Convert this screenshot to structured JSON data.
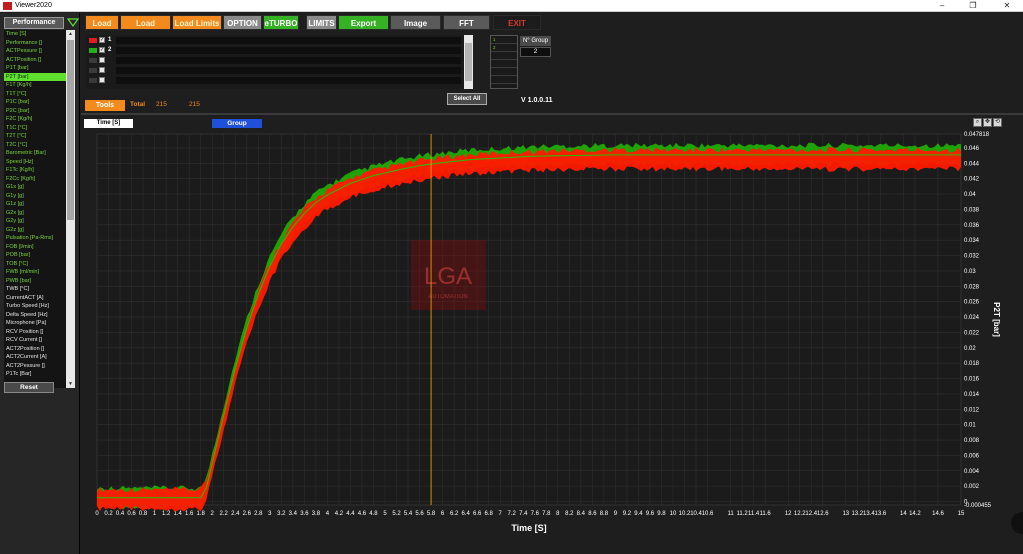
{
  "window": {
    "title": "Viewer2020",
    "minimize": "–",
    "restore": "❐",
    "close": "✕"
  },
  "sidebar": {
    "performance_label": "Performance",
    "selected_index": 8,
    "signals": [
      {
        "label": "Time [S]",
        "color": "green"
      },
      {
        "label": "Performance []",
        "color": "green"
      },
      {
        "label": "ACTPessure []",
        "color": "green"
      },
      {
        "label": "ACTPosition []",
        "color": "green"
      },
      {
        "label": "P1T [bar]",
        "color": "green"
      },
      {
        "label": "P2T [bar]",
        "color": "selected"
      },
      {
        "label": "F1T [Kg/h]",
        "color": "green"
      },
      {
        "label": "T1T [°C]",
        "color": "green"
      },
      {
        "label": "P1C [bar]",
        "color": "green"
      },
      {
        "label": "P2C [bar]",
        "color": "green"
      },
      {
        "label": "F2C [Kg/h]",
        "color": "green"
      },
      {
        "label": "T1C [°C]",
        "color": "green"
      },
      {
        "label": "T2T [°C]",
        "color": "green"
      },
      {
        "label": "T2C [°C]",
        "color": "green"
      },
      {
        "label": "Barometric [Bar]",
        "color": "green"
      },
      {
        "label": "Speed [Hz]",
        "color": "green"
      },
      {
        "label": "F1Tc [Kg/h]",
        "color": "green"
      },
      {
        "label": "F2Cc [Kg/h]",
        "color": "green"
      },
      {
        "label": "G1x [g]",
        "color": "green"
      },
      {
        "label": "G1y [g]",
        "color": "green"
      },
      {
        "label": "G1z [g]",
        "color": "green"
      },
      {
        "label": "G2x [g]",
        "color": "green"
      },
      {
        "label": "G2y [g]",
        "color": "green"
      },
      {
        "label": "G2z [g]",
        "color": "green"
      },
      {
        "label": "Pulsation [Pa-Rms]",
        "color": "green"
      },
      {
        "label": "FOB [l/min]",
        "color": "green"
      },
      {
        "label": "POB [bar]",
        "color": "green"
      },
      {
        "label": "TOB [°C]",
        "color": "green"
      },
      {
        "label": "FWB [ml/min]",
        "color": "green"
      },
      {
        "label": "PWB [bar]",
        "color": "green"
      },
      {
        "label": "TWB [°C]",
        "color": "white"
      },
      {
        "label": "CurrentACT [A]",
        "color": "white"
      },
      {
        "label": "Turbo Speed [Hz]",
        "color": "white"
      },
      {
        "label": "Delta Speed [Hz]",
        "color": "white"
      },
      {
        "label": "Microphone [Pa]",
        "color": "white"
      },
      {
        "label": "RCV Position []",
        "color": "white"
      },
      {
        "label": "RCV Current []",
        "color": "white"
      },
      {
        "label": "ACT2Position []",
        "color": "white"
      },
      {
        "label": "ACT2Current [A]",
        "color": "white"
      },
      {
        "label": "ACT2Pessure []",
        "color": "white"
      },
      {
        "label": "P1Tc [Bar]",
        "color": "white"
      }
    ],
    "reset_label": "Reset"
  },
  "toolbar": {
    "load": "Load",
    "load_groups": "Load Groups",
    "load_limits": "Load Limits",
    "option": "OPTION",
    "eturbo": "eTURBO",
    "limits": "LIMITS",
    "export": "Export",
    "image": "Image",
    "fft": "FFT",
    "exit": "EXIT"
  },
  "channels": [
    {
      "num": "1",
      "color": "#e01c1c",
      "checked": true
    },
    {
      "num": "2",
      "color": "#22b014",
      "checked": true
    },
    {
      "num": "",
      "color": "#3a3a3a",
      "checked": false
    },
    {
      "num": "",
      "color": "#3a3a3a",
      "checked": false
    },
    {
      "num": "",
      "color": "#3a3a3a",
      "checked": false
    }
  ],
  "select_all_label": "Select All",
  "group_panel": {
    "label": "N° Group",
    "value": "2",
    "items": [
      "1",
      "2",
      "",
      "",
      "",
      ""
    ]
  },
  "version": "V 1.0.0.11",
  "tools": {
    "label": "Tools",
    "total_label": "Total",
    "total_value_1": "215",
    "total_value_2": "215"
  },
  "chart_header": {
    "x_variable": "Time [S]",
    "group_label": "Group"
  },
  "colors": {
    "accent": "#f28a1e",
    "green": "#34b224",
    "grid": "#2f2f2f",
    "background": "#1e1e1e",
    "series_red": "#ff1a00",
    "series_green": "#21c400",
    "cursor": "#ffaa00"
  },
  "chart_data": {
    "type": "line",
    "xlabel": "Time [S]",
    "ylabel": "P2T [bar]",
    "xlim": [
      0,
      15
    ],
    "ylim": [
      -0.000455,
      0.047818
    ],
    "x_ticks": [
      "0",
      "0.2",
      "0.4",
      "0.6",
      "0.8",
      "1",
      "1.2",
      "1.4",
      "1.6",
      "1.8",
      "2",
      "2.2",
      "2.4",
      "2.6",
      "2.8",
      "3",
      "3.2",
      "3.4",
      "3.6",
      "3.8",
      "4",
      "4.2",
      "4.4",
      "4.6",
      "4.8",
      "5",
      "5.2",
      "5.4",
      "5.6",
      "5.8",
      "6",
      "6.2",
      "6.4",
      "6.6",
      "6.8",
      "7",
      "7.2",
      "7.4",
      "7.6",
      "7.8",
      "8",
      "8.2",
      "8.4",
      "8.6",
      "8.8",
      "9",
      "9.2",
      "9.4",
      "9.6",
      "9.8",
      "10",
      "10.2",
      "10.4",
      "10.6",
      "11",
      "11.2",
      "11.4",
      "11.6",
      "12",
      "12.2",
      "12.4",
      "12.6",
      "13",
      "13.2",
      "13.4",
      "13.6",
      "14",
      "14.2",
      "14.6",
      "15"
    ],
    "x_tick_values": [
      0,
      0.2,
      0.4,
      0.6,
      0.8,
      1,
      1.2,
      1.4,
      1.6,
      1.8,
      2,
      2.2,
      2.4,
      2.6,
      2.8,
      3,
      3.2,
      3.4,
      3.6,
      3.8,
      4,
      4.2,
      4.4,
      4.6,
      4.8,
      5,
      5.2,
      5.4,
      5.6,
      5.8,
      6,
      6.2,
      6.4,
      6.6,
      6.8,
      7,
      7.2,
      7.4,
      7.6,
      7.8,
      8,
      8.2,
      8.4,
      8.6,
      8.8,
      9,
      9.2,
      9.4,
      9.6,
      9.8,
      10,
      10.2,
      10.4,
      10.6,
      11,
      11.2,
      11.4,
      11.6,
      12,
      12.2,
      12.4,
      12.6,
      13,
      13.2,
      13.4,
      13.6,
      14,
      14.2,
      14.6,
      15
    ],
    "y_ticks": [
      "-0.000455",
      "0",
      "0.002",
      "0.004",
      "0.006",
      "0.008",
      "0.01",
      "0.012",
      "0.014",
      "0.016",
      "0.018",
      "0.02",
      "0.022",
      "0.024",
      "0.026",
      "0.028",
      "0.03",
      "0.032",
      "0.034",
      "0.036",
      "0.038",
      "0.04",
      "0.042",
      "0.044",
      "0.046",
      "0.047818"
    ],
    "y_tick_values": [
      -0.000455,
      0,
      0.002,
      0.004,
      0.006,
      0.008,
      0.01,
      0.012,
      0.014,
      0.016,
      0.018,
      0.02,
      0.022,
      0.024,
      0.026,
      0.028,
      0.03,
      0.032,
      0.034,
      0.036,
      0.038,
      0.04,
      0.042,
      0.044,
      0.046,
      0.047818
    ],
    "cursor_x": 5.8,
    "series": [
      {
        "group": "1",
        "color": "#ff1a00",
        "x": [
          0,
          1.8,
          1.9,
          2.0,
          2.2,
          2.4,
          2.6,
          2.8,
          3.0,
          3.2,
          3.4,
          3.6,
          3.8,
          4.0,
          4.4,
          4.8,
          5.2,
          5.6,
          6.0,
          6.5,
          7.0,
          7.5,
          8.0,
          9.0,
          10.0,
          11.0,
          12.0,
          13.0,
          14.0,
          15.0
        ],
        "y": [
          0.0003,
          0.0003,
          0.0015,
          0.0045,
          0.0105,
          0.0165,
          0.0218,
          0.0262,
          0.0298,
          0.0327,
          0.035,
          0.0368,
          0.0382,
          0.0393,
          0.0408,
          0.0418,
          0.0425,
          0.0431,
          0.0435,
          0.0439,
          0.0441,
          0.0443,
          0.0444,
          0.0445,
          0.0445,
          0.0445,
          0.0445,
          0.0445,
          0.0445,
          0.0445
        ]
      },
      {
        "group": "2",
        "color": "#21c400",
        "x": [
          0,
          1.8,
          1.9,
          2.0,
          2.2,
          2.4,
          2.6,
          2.8,
          3.0,
          3.2,
          3.4,
          3.6,
          3.8,
          4.0,
          4.4,
          4.8,
          5.2,
          5.6,
          6.0,
          6.5,
          7.0,
          7.5,
          8.0,
          9.0,
          10.0,
          11.0,
          12.0,
          13.0,
          14.0,
          15.0
        ],
        "y": [
          0.0005,
          0.0005,
          0.0018,
          0.005,
          0.0112,
          0.0173,
          0.0226,
          0.027,
          0.0306,
          0.0335,
          0.0357,
          0.0375,
          0.0389,
          0.0399,
          0.0414,
          0.0424,
          0.0431,
          0.0437,
          0.0441,
          0.0445,
          0.0447,
          0.0449,
          0.045,
          0.0451,
          0.0451,
          0.0451,
          0.0451,
          0.0451,
          0.0451,
          0.0451
        ]
      }
    ]
  },
  "watermark": {
    "logo": "LGA",
    "sub": "AUTOMATION"
  }
}
